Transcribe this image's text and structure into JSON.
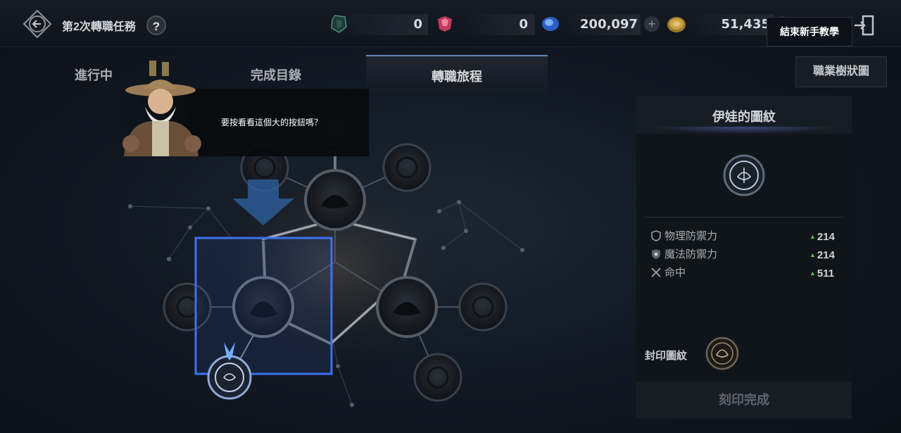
{
  "header": {
    "quest_title": "第2次轉職任務",
    "help_label": "?",
    "currencies": [
      {
        "name": "crystal-shard",
        "value": "0"
      },
      {
        "name": "red-gem",
        "value": "0"
      },
      {
        "name": "blue-gem",
        "value": "200,097"
      },
      {
        "name": "gold-coin",
        "value": "51,435"
      }
    ],
    "tutorial_button": "結束新手教學"
  },
  "tabs": [
    {
      "label": "進行中",
      "active": false
    },
    {
      "label": "完成目錄",
      "active": false
    },
    {
      "label": "轉職旅程",
      "active": true
    }
  ],
  "job_tree_button": "職業樹狀圖",
  "dialog": {
    "text": "要按看看這個大的按鈕嗎？"
  },
  "panel": {
    "title": "伊娃的圖紋",
    "stats": [
      {
        "label": "物理防禦力",
        "value": "214",
        "icon": "shield-icon"
      },
      {
        "label": "魔法防禦力",
        "value": "214",
        "icon": "magic-shield-icon"
      },
      {
        "label": "命中",
        "value": "511",
        "icon": "crossed-swords-icon"
      }
    ],
    "seal_label": "封印圖紋",
    "engrave_button": "刻印完成"
  },
  "colors": {
    "accent": "#3f6fe0",
    "stat_up": "#5dbb4a",
    "highlight_box": "#2f5ff0"
  }
}
